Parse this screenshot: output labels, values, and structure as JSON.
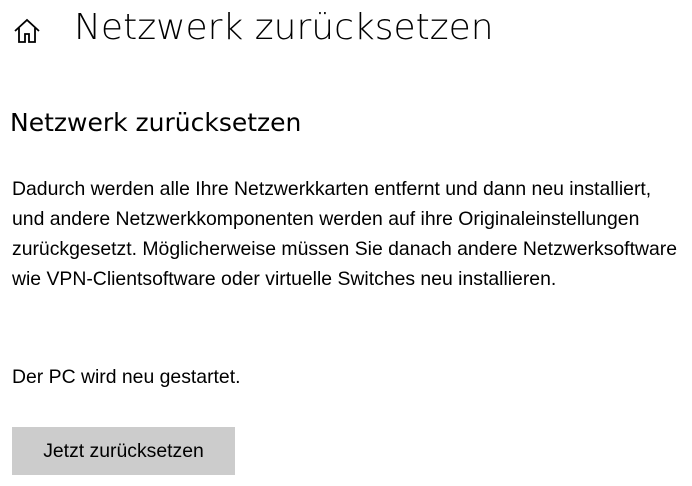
{
  "header": {
    "home_icon": "home-icon",
    "title": "Netzwerk zurücksetzen"
  },
  "section": {
    "title": "Netzwerk zurücksetzen",
    "description": "Dadurch werden alle Ihre Netzwerkkarten entfernt und dann neu installiert, und andere Netzwerkkomponenten werden auf ihre Originaleinstellungen zurückgesetzt. Möglicherweise müssen Sie danach andere Netzwerksoftware wie VPN-Clientsoftware oder virtuelle Switches neu installieren.",
    "restart_note": "Der PC wird neu gestartet.",
    "reset_button_label": "Jetzt zurücksetzen"
  },
  "colors": {
    "background": "#ffffff",
    "text": "#000000",
    "button_background": "#cccccc"
  }
}
